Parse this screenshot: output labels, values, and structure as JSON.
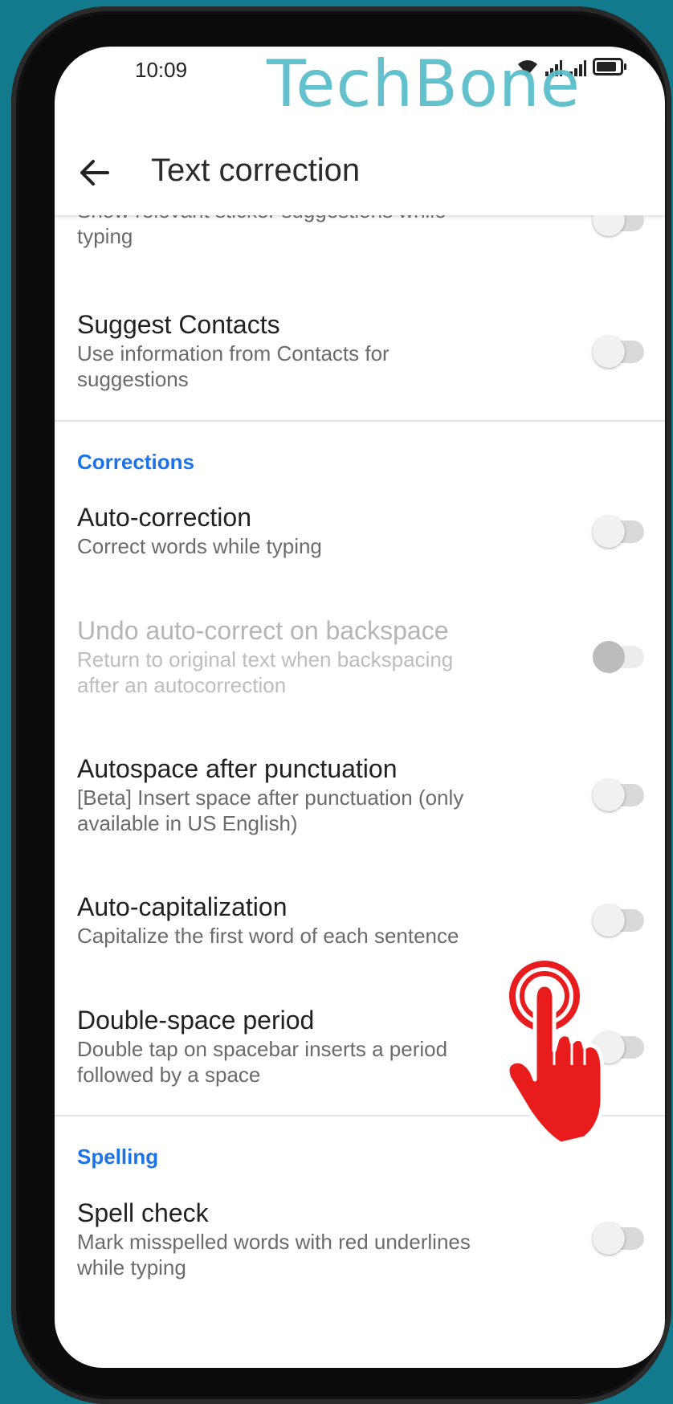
{
  "status_bar": {
    "time": "10:09"
  },
  "watermark": "TechBone",
  "appbar": {
    "title": "Text correction"
  },
  "items": {
    "sticker": {
      "title": "",
      "subtitle": "Show relevant sticker suggestions while typing"
    },
    "contacts": {
      "title": "Suggest Contacts",
      "subtitle": "Use information from Contacts for suggestions"
    },
    "autocorrect": {
      "title": "Auto-correction",
      "subtitle": "Correct words while typing"
    },
    "undo": {
      "title": "Undo auto-correct on backspace",
      "subtitle": "Return to original text when backspacing after an autocorrection"
    },
    "autospace": {
      "title": "Autospace after punctuation",
      "subtitle": "[Beta] Insert space after punctuation (only available in US English)"
    },
    "autocap": {
      "title": "Auto-capitalization",
      "subtitle": "Capitalize the first word of each sentence"
    },
    "doublespace": {
      "title": "Double-space period",
      "subtitle": "Double tap on spacebar inserts a period followed by a space"
    },
    "spellcheck": {
      "title": "Spell check",
      "subtitle": "Mark misspelled words with red underlines while typing"
    }
  },
  "sections": {
    "corrections": "Corrections",
    "spelling": "Spelling"
  },
  "colors": {
    "accent": "#1a73e8",
    "background": "#127a8c",
    "pointer": "#e81c1c"
  }
}
